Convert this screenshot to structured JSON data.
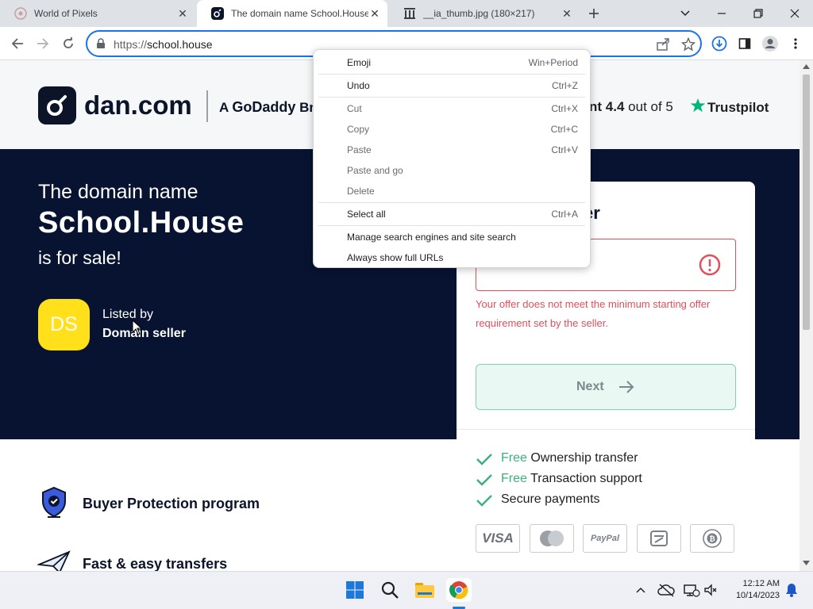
{
  "browser": {
    "tabs": [
      {
        "title": "World of Pixels",
        "active": false
      },
      {
        "title": "The domain name School.House",
        "active": true
      },
      {
        "title": "__ia_thumb.jpg (180×217)",
        "active": false
      }
    ],
    "url_prefix": "https://",
    "url_host": "school.house",
    "accent_color": "#1a73e8"
  },
  "site": {
    "logo_text": "dan.com",
    "brand_prefix": "A",
    "brand_name": "GoDaddy",
    "brand_suffix": "Bra",
    "rating_fragment": "nt",
    "rating_value": "4.4",
    "rating_suffix": "out of 5",
    "trustpilot": "Trustpilot",
    "colors": {
      "hero_bg": "#071330",
      "avatar": "#ffe01a",
      "error": "#e24e5a",
      "success": "#3ab07e"
    }
  },
  "hero": {
    "line1": "The domain name",
    "domain": "School.House",
    "line3": "is for sale!",
    "avatar_initials": "DS",
    "listed_by_label": "Listed by",
    "seller_name": "Domain seller"
  },
  "offer_card": {
    "title_fragment": "er",
    "error_message": "Your offer does not meet the minimum starting offer requirement set by the seller.",
    "next_label": "Next",
    "benefits": [
      {
        "prefix": "Free",
        "text": "Ownership transfer"
      },
      {
        "prefix": "Free",
        "text": "Transaction support"
      },
      {
        "prefix": "",
        "text": "Secure payments"
      }
    ],
    "payment_methods": [
      "VISA",
      "mastercard",
      "PayPal",
      "alipay",
      "bitcoin"
    ]
  },
  "features": [
    {
      "icon": "shield-icon",
      "label": "Buyer Protection program"
    },
    {
      "icon": "paper-plane-icon",
      "label": "Fast & easy transfers"
    }
  ],
  "context_menu": {
    "items": [
      {
        "label": "Emoji",
        "shortcut": "Win+Period",
        "enabled": true
      },
      {
        "label": "Undo",
        "shortcut": "Ctrl+Z",
        "enabled": true
      },
      {
        "label": "Cut",
        "shortcut": "Ctrl+X",
        "enabled": false
      },
      {
        "label": "Copy",
        "shortcut": "Ctrl+C",
        "enabled": false
      },
      {
        "label": "Paste",
        "shortcut": "Ctrl+V",
        "enabled": false
      },
      {
        "label": "Paste and go",
        "shortcut": "",
        "enabled": false
      },
      {
        "label": "Delete",
        "shortcut": "",
        "enabled": false
      },
      {
        "label": "Select all",
        "shortcut": "Ctrl+A",
        "enabled": true
      },
      {
        "label": "Manage search engines and site search",
        "shortcut": "",
        "enabled": true
      },
      {
        "label": "Always show full URLs",
        "shortcut": "",
        "enabled": true
      }
    ]
  },
  "taskbar": {
    "time": "12:12 AM",
    "date": "10/14/2023"
  }
}
